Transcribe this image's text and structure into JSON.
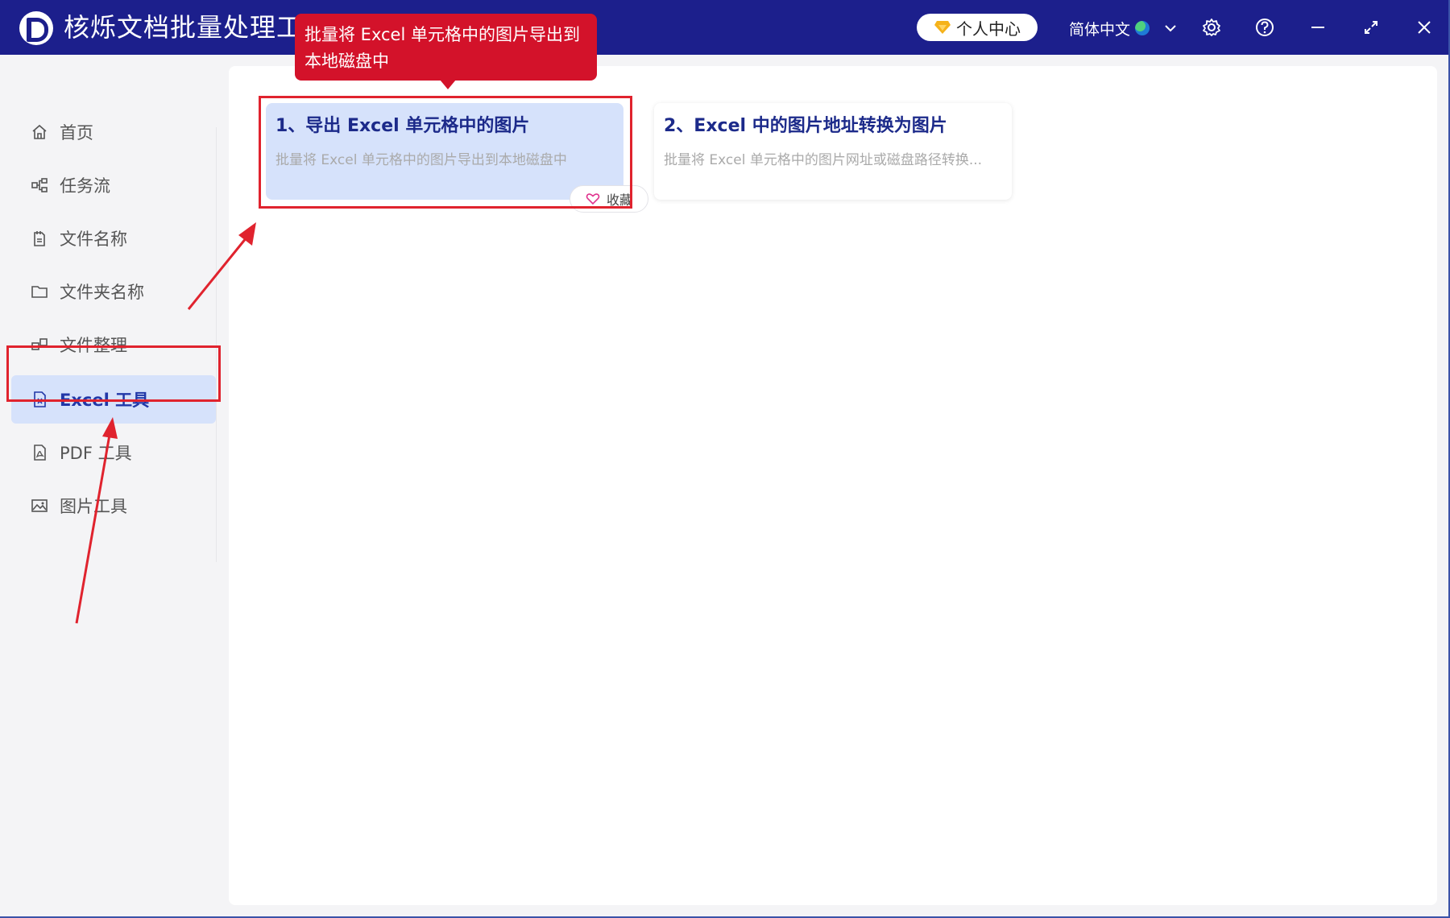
{
  "app": {
    "title": "核烁文档批量处理工具",
    "user_center_label": "个人中心",
    "language_label": "简体中文"
  },
  "sidebar": {
    "items": [
      {
        "label": "首页",
        "icon": "home-icon"
      },
      {
        "label": "任务流",
        "icon": "workflow-icon"
      },
      {
        "label": "文件名称",
        "icon": "file-name-icon"
      },
      {
        "label": "文件夹名称",
        "icon": "folder-icon"
      },
      {
        "label": "文件整理",
        "icon": "organize-icon"
      },
      {
        "label": "Excel 工具",
        "icon": "excel-file-icon",
        "active": true
      },
      {
        "label": "PDF 工具",
        "icon": "pdf-file-icon"
      },
      {
        "label": "图片工具",
        "icon": "image-icon"
      }
    ]
  },
  "main": {
    "cards": [
      {
        "title": "1、导出 Excel 单元格中的图片",
        "desc": "批量将 Excel 单元格中的图片导出到本地磁盘中",
        "selected": true
      },
      {
        "title": "2、Excel 中的图片地址转换为图片",
        "desc": "批量将 Excel 单元格中的图片网址或磁盘路径转换..."
      }
    ],
    "favorite_label": "收藏"
  },
  "tooltip": {
    "text": "批量将 Excel 单元格中的图片导出到本地磁盘中"
  },
  "colors": {
    "titlebar": "#1c1f8c",
    "active_item_bg": "#d6e2fb",
    "active_text": "#2238a8",
    "annotation_red": "#e0232e",
    "tooltip_bg": "#d3122a"
  }
}
